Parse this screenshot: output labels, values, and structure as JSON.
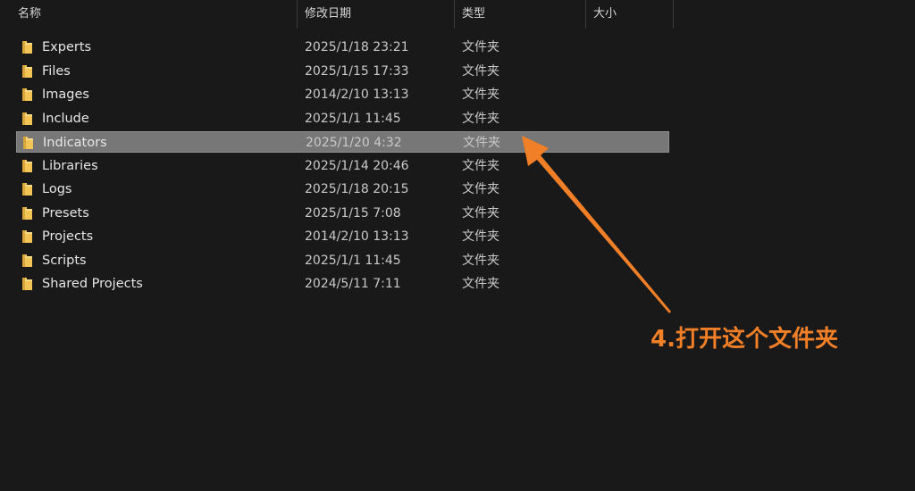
{
  "columns": {
    "name": "名称",
    "date": "修改日期",
    "type": "类型",
    "size": "大小"
  },
  "sort_indicator": "^",
  "rows": [
    {
      "name": "Experts",
      "date": "2025/1/18 23:21",
      "type": "文件夹",
      "size": "",
      "selected": false
    },
    {
      "name": "Files",
      "date": "2025/1/15 17:33",
      "type": "文件夹",
      "size": "",
      "selected": false
    },
    {
      "name": "Images",
      "date": "2014/2/10 13:13",
      "type": "文件夹",
      "size": "",
      "selected": false
    },
    {
      "name": "Include",
      "date": "2025/1/1 11:45",
      "type": "文件夹",
      "size": "",
      "selected": false
    },
    {
      "name": "Indicators",
      "date": "2025/1/20 4:32",
      "type": "文件夹",
      "size": "",
      "selected": true
    },
    {
      "name": "Libraries",
      "date": "2025/1/14 20:46",
      "type": "文件夹",
      "size": "",
      "selected": false
    },
    {
      "name": "Logs",
      "date": "2025/1/18 20:15",
      "type": "文件夹",
      "size": "",
      "selected": false
    },
    {
      "name": "Presets",
      "date": "2025/1/15 7:08",
      "type": "文件夹",
      "size": "",
      "selected": false
    },
    {
      "name": "Projects",
      "date": "2014/2/10 13:13",
      "type": "文件夹",
      "size": "",
      "selected": false
    },
    {
      "name": "Scripts",
      "date": "2025/1/1 11:45",
      "type": "文件夹",
      "size": "",
      "selected": false
    },
    {
      "name": "Shared Projects",
      "date": "2024/5/11 7:11",
      "type": "文件夹",
      "size": "",
      "selected": false
    }
  ],
  "annotation": {
    "text": "4.打开这个文件夹",
    "color": "#f07f27"
  },
  "colors": {
    "background": "#191919",
    "selected_row": "#777777",
    "folder": "#f3c557"
  },
  "icons": {
    "folder": "folder-icon",
    "arrow": "annotation-arrow"
  }
}
